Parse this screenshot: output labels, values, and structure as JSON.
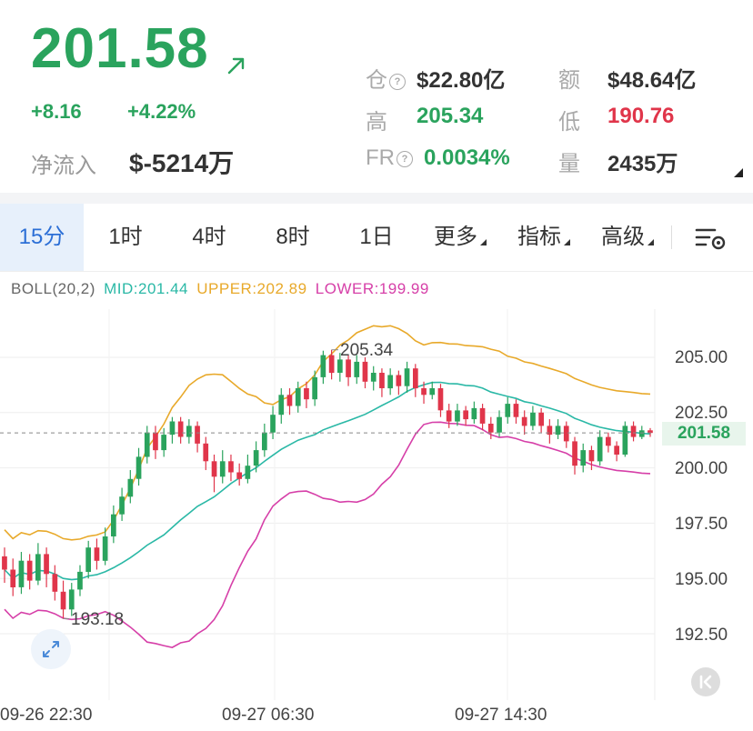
{
  "quote": {
    "price": "201.58",
    "change": "+8.16",
    "change_pct": "+4.22%",
    "net_inflow_label": "净流入",
    "net_inflow": "$-5214万",
    "position_label": "仓",
    "position": "$22.80亿",
    "amount_label": "额",
    "amount": "$48.64亿",
    "high_label": "高",
    "high": "205.34",
    "low_label": "低",
    "low": "190.76",
    "fr_label": "FR",
    "fr": "0.0034%",
    "volume_label": "量",
    "volume": "2435万",
    "help_icon_glyph": "?"
  },
  "colors": {
    "up": "#2aa35d",
    "down": "#e0354a",
    "mid": "#2ab8a6",
    "upper": "#e8a92a",
    "lower": "#d63fa8",
    "accent": "#2c6fd6"
  },
  "tabs": [
    {
      "label": "15分",
      "active": true
    },
    {
      "label": "1时"
    },
    {
      "label": "4时"
    },
    {
      "label": "8时"
    },
    {
      "label": "1日"
    },
    {
      "label": "更多"
    },
    {
      "label": "指标"
    },
    {
      "label": "高级"
    }
  ],
  "indicator": {
    "name": "BOLL(20,2)",
    "mid": "MID:201.44",
    "upper": "UPPER:202.89",
    "lower": "LOWER:199.99"
  },
  "chart_data": {
    "type": "candlestick",
    "y_ticks": [
      "205.00",
      "202.50",
      "200.00",
      "197.50",
      "195.00",
      "192.50"
    ],
    "ylim": [
      191.8,
      206.6
    ],
    "x_labels": [
      "09-26 22:30",
      "09-27 06:30",
      "09-27 14:30"
    ],
    "current_price": "201.58",
    "high_annotation": "205.34",
    "low_annotation": "193.18",
    "candles": [
      [
        196.0,
        195.4,
        196.4,
        194.8
      ],
      [
        195.4,
        194.6,
        195.9,
        194.2
      ],
      [
        194.6,
        195.8,
        196.2,
        194.3
      ],
      [
        195.8,
        194.9,
        196.1,
        194.5
      ],
      [
        194.9,
        196.1,
        196.6,
        194.7
      ],
      [
        196.1,
        195.2,
        196.4,
        194.6
      ],
      [
        195.2,
        194.4,
        195.6,
        194.0
      ],
      [
        194.4,
        193.6,
        194.9,
        193.18
      ],
      [
        193.6,
        194.5,
        194.8,
        193.3
      ],
      [
        194.5,
        195.3,
        195.6,
        194.2
      ],
      [
        195.3,
        196.4,
        196.7,
        195.0
      ],
      [
        196.4,
        195.8,
        196.8,
        195.4
      ],
      [
        195.8,
        196.9,
        197.3,
        195.6
      ],
      [
        196.9,
        197.9,
        198.3,
        196.6
      ],
      [
        197.9,
        198.7,
        199.1,
        197.6
      ],
      [
        198.7,
        199.5,
        199.9,
        198.4
      ],
      [
        199.5,
        200.5,
        200.9,
        199.2
      ],
      [
        200.5,
        201.6,
        201.9,
        200.2
      ],
      [
        201.6,
        200.8,
        201.9,
        200.4
      ],
      [
        200.8,
        201.5,
        201.8,
        200.5
      ],
      [
        201.5,
        202.1,
        202.3,
        201.1
      ],
      [
        202.1,
        201.4,
        202.3,
        201.1
      ],
      [
        201.4,
        201.9,
        202.2,
        201.1
      ],
      [
        201.9,
        201.1,
        202.1,
        200.7
      ],
      [
        201.1,
        200.3,
        201.4,
        199.9
      ],
      [
        200.3,
        199.6,
        200.6,
        198.9
      ],
      [
        199.6,
        200.3,
        200.8,
        199.3
      ],
      [
        200.3,
        199.8,
        200.6,
        199.4
      ],
      [
        199.8,
        199.5,
        200.2,
        199.2
      ],
      [
        199.5,
        200.1,
        200.6,
        199.3
      ],
      [
        200.1,
        200.8,
        201.2,
        199.8
      ],
      [
        200.8,
        201.6,
        202.0,
        200.5
      ],
      [
        201.6,
        202.4,
        202.8,
        201.3
      ],
      [
        202.4,
        203.3,
        203.6,
        202.0
      ],
      [
        203.3,
        202.8,
        203.6,
        202.4
      ],
      [
        202.8,
        203.6,
        203.9,
        202.5
      ],
      [
        203.6,
        203.1,
        203.9,
        202.7
      ],
      [
        203.1,
        204.1,
        204.4,
        202.8
      ],
      [
        204.1,
        205.1,
        205.3,
        203.8
      ],
      [
        205.1,
        204.3,
        205.34,
        204.0
      ],
      [
        204.3,
        204.9,
        205.2,
        203.9
      ],
      [
        204.9,
        204.1,
        205.1,
        203.7
      ],
      [
        204.1,
        204.8,
        205.1,
        203.8
      ],
      [
        204.8,
        203.9,
        205.0,
        203.6
      ],
      [
        203.9,
        204.3,
        204.6,
        203.5
      ],
      [
        204.3,
        203.6,
        204.5,
        203.2
      ],
      [
        203.6,
        204.2,
        204.5,
        203.3
      ],
      [
        204.2,
        203.7,
        204.4,
        203.3
      ],
      [
        203.7,
        204.5,
        204.8,
        203.4
      ],
      [
        204.5,
        203.6,
        204.7,
        203.2
      ],
      [
        203.6,
        203.3,
        203.9,
        202.9
      ],
      [
        203.3,
        203.6,
        203.9,
        203.1
      ],
      [
        203.6,
        202.6,
        203.8,
        202.3
      ],
      [
        202.6,
        202.1,
        202.9,
        201.8
      ],
      [
        202.1,
        202.6,
        202.9,
        201.9
      ],
      [
        202.6,
        202.2,
        202.8,
        201.9
      ],
      [
        202.2,
        202.7,
        203.0,
        202.0
      ],
      [
        202.7,
        202.0,
        202.9,
        201.7
      ],
      [
        202.0,
        201.6,
        202.3,
        201.3
      ],
      [
        201.6,
        202.3,
        202.6,
        201.4
      ],
      [
        202.3,
        202.9,
        203.2,
        202.0
      ],
      [
        202.9,
        202.3,
        203.1,
        202.0
      ],
      [
        202.3,
        201.9,
        202.6,
        201.5
      ],
      [
        201.9,
        202.5,
        202.8,
        201.7
      ],
      [
        202.5,
        201.9,
        202.7,
        201.6
      ],
      [
        201.9,
        201.5,
        202.2,
        201.1
      ],
      [
        201.5,
        201.9,
        202.2,
        201.3
      ],
      [
        201.9,
        201.2,
        202.1,
        200.9
      ],
      [
        201.2,
        200.1,
        201.4,
        199.7
      ],
      [
        200.1,
        200.8,
        201.1,
        199.8
      ],
      [
        200.8,
        200.3,
        201.0,
        199.9
      ],
      [
        200.3,
        201.4,
        201.7,
        200.1
      ],
      [
        201.4,
        201.0,
        201.6,
        200.7
      ],
      [
        201.0,
        200.6,
        201.2,
        200.3
      ],
      [
        200.6,
        201.9,
        202.1,
        200.5
      ],
      [
        201.9,
        201.4,
        202.1,
        201.2
      ],
      [
        201.4,
        201.7,
        201.9,
        201.3
      ],
      [
        201.7,
        201.58,
        201.8,
        201.4
      ]
    ]
  }
}
